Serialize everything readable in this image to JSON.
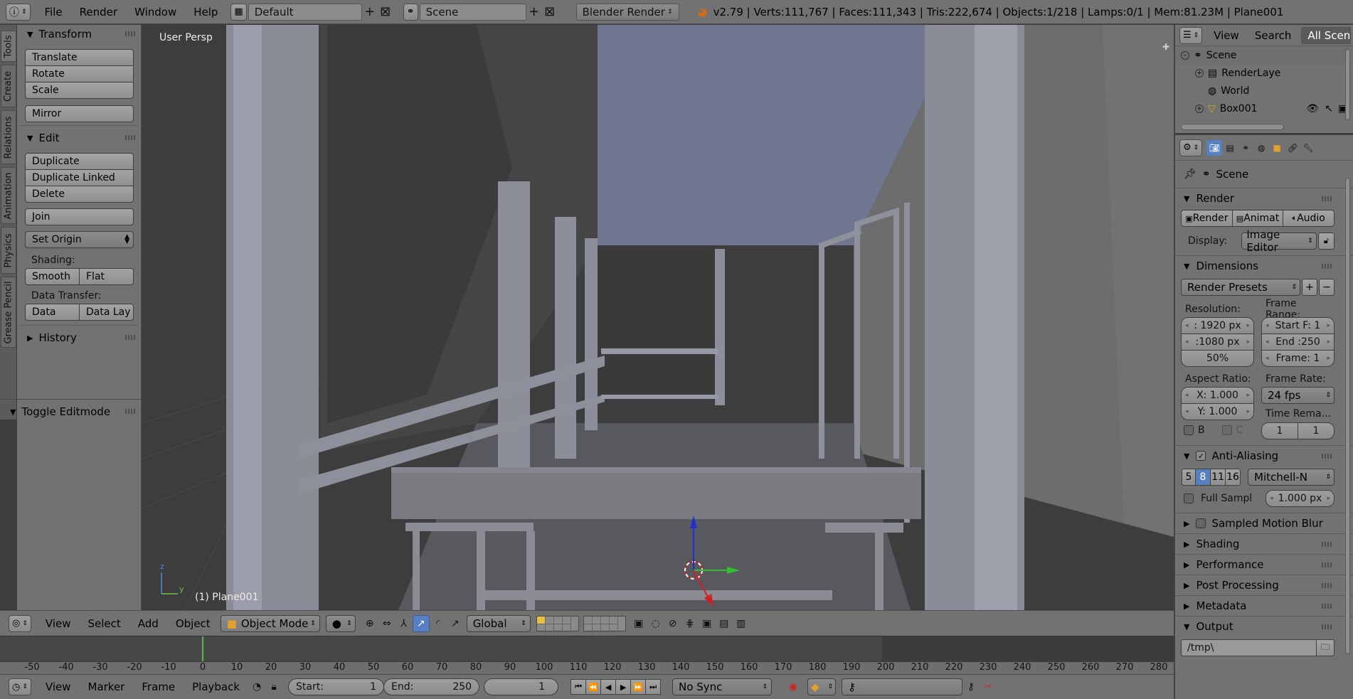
{
  "topbar": {
    "menus": [
      "File",
      "Render",
      "Window",
      "Help"
    ],
    "layout": "Default",
    "scene": "Scene",
    "engine": "Blender Render",
    "stats": "v2.79 | Verts:111,767 | Faces:111,343 | Tris:222,674 | Objects:1/218 | Lamps:0/1 | Mem:81.23M | Plane001"
  },
  "tabs": [
    "Tools",
    "Create",
    "Relations",
    "Animation",
    "Physics",
    "Grease Pencil"
  ],
  "toolshelf": {
    "transform": {
      "title": "Transform",
      "buttons": [
        "Translate",
        "Rotate",
        "Scale"
      ],
      "mirror": "Mirror"
    },
    "edit": {
      "title": "Edit",
      "buttons": [
        "Duplicate",
        "Duplicate Linked",
        "Delete"
      ],
      "join": "Join",
      "set_origin": "Set Origin",
      "shading_label": "Shading:",
      "smooth": "Smooth",
      "flat": "Flat",
      "data_transfer_label": "Data Transfer:",
      "data": "Data",
      "data_lay": "Data Lay"
    },
    "history": "History",
    "toggle_editmode": "Toggle Editmode"
  },
  "viewport": {
    "view_name": "User Persp",
    "object_label": "(1) Plane001",
    "axis_z": "z",
    "axis_y": "y"
  },
  "vp_header": {
    "menus": [
      "View",
      "Select",
      "Add",
      "Object"
    ],
    "mode": "Object Mode",
    "orientation": "Global"
  },
  "timeline": {
    "ticks": [
      "-50",
      "-40",
      "-30",
      "-20",
      "-10",
      "0",
      "10",
      "20",
      "30",
      "40",
      "50",
      "60",
      "70",
      "80",
      "90",
      "100",
      "110",
      "120",
      "130",
      "140",
      "150",
      "160",
      "170",
      "180",
      "190",
      "200",
      "210",
      "220",
      "230",
      "240",
      "250",
      "260",
      "270",
      "280"
    ],
    "current_frame_marker": 0,
    "range_end_marker": 250
  },
  "tl_header": {
    "menus": [
      "View",
      "Marker",
      "Frame",
      "Playback"
    ],
    "start_label": "Start:",
    "start_value": "1",
    "end_label": "End:",
    "end_value": "250",
    "current_frame": "1",
    "sync": "No Sync"
  },
  "outliner": {
    "menus": [
      "View",
      "Search"
    ],
    "filter": "All Scenes",
    "items": [
      {
        "label": "Scene",
        "icon": "scene-icon"
      },
      {
        "label": "RenderLaye",
        "icon": "render-layers-icon"
      },
      {
        "label": "World",
        "icon": "world-icon"
      },
      {
        "label": "Box001",
        "icon": "mesh-icon"
      }
    ]
  },
  "properties": {
    "context": "Scene",
    "render": {
      "title": "Render",
      "render_btn": "Render",
      "animation_btn": "Animat",
      "audio_btn": "Audio",
      "display_label": "Display:",
      "display_value": "Image Editor"
    },
    "dimensions": {
      "title": "Dimensions",
      "presets": "Render Presets",
      "resolution_label": "Resolution:",
      "res_x": ": 1920 px",
      "res_y": ":1080 px",
      "res_pct": "50%",
      "frame_range_label": "Frame Range:",
      "start": "Start F: 1",
      "end": "End :250",
      "frame": "Frame: 1",
      "aspect_label": "Aspect Ratio:",
      "aspect_x": "X:  1.000",
      "aspect_y": "Y:  1.000",
      "frame_rate_label": "Frame Rate:",
      "fps": "24 fps",
      "time_remap_label": "Time Rema...",
      "remap_old": "1",
      "remap_new": "1",
      "border": "B",
      "crop": "C"
    },
    "anti_aliasing": {
      "title": "Anti-Aliasing",
      "samples": [
        "5",
        "8",
        "11",
        "16"
      ],
      "active_sample": "8",
      "filter": "Mitchell-N",
      "full_sample": "Full Sampl",
      "filter_size": "1.000 px"
    },
    "collapsed_panels": [
      "Sampled Motion Blur",
      "Shading",
      "Performance",
      "Post Processing",
      "Metadata"
    ],
    "output": {
      "title": "Output",
      "path": "/tmp\\"
    }
  },
  "colors": {
    "accent": "#5680c2",
    "panel": "#727272",
    "viewport": "#3d3d3d",
    "frame_cursor": "#5aba3c"
  }
}
